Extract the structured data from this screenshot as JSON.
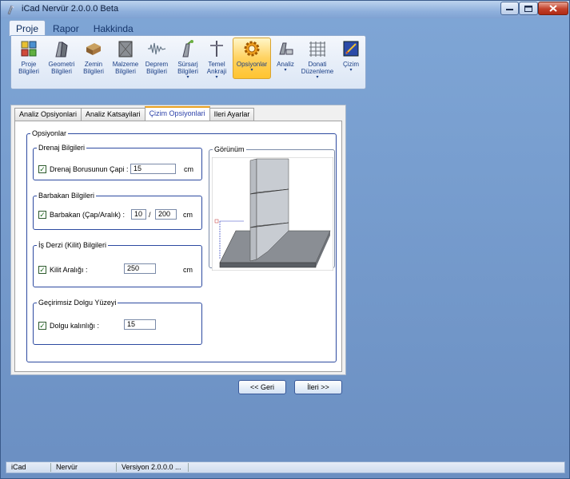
{
  "window": {
    "title": "iCad Nervür 2.0.0.0 Beta"
  },
  "ribbon": {
    "tabs": [
      {
        "label": "Proje"
      },
      {
        "label": "Rapor"
      },
      {
        "label": "Hakkinda"
      }
    ],
    "buttons": [
      {
        "label": "Proje\nBilgileri",
        "icon": "project-info-icon"
      },
      {
        "label": "Geometri\nBilgileri",
        "icon": "geometry-icon"
      },
      {
        "label": "Zemin\nBilgileri",
        "icon": "soil-icon"
      },
      {
        "label": "Malzeme\nBilgileri",
        "icon": "material-icon"
      },
      {
        "label": "Deprem\nBilgileri",
        "icon": "earthquake-icon"
      },
      {
        "label": "Sürsarj\nBilgileri",
        "icon": "surcharge-icon"
      },
      {
        "label": "Temel\nAnkraji",
        "icon": "anchor-icon"
      },
      {
        "label": "Opsiyonlar",
        "icon": "gear-icon"
      },
      {
        "label": "Analiz",
        "icon": "analysis-icon"
      },
      {
        "label": "Donati\nDüzenleme",
        "icon": "rebar-icon"
      },
      {
        "label": "Çizim",
        "icon": "drawing-icon"
      }
    ],
    "dropdown_marker": "▾"
  },
  "panel": {
    "tabs": [
      {
        "label": "Analiz Opsiyonlari"
      },
      {
        "label": "Analiz Katsayilari"
      },
      {
        "label": "Çizim Opsiyonlari"
      },
      {
        "label": "Ileri Ayarlar"
      }
    ],
    "options_legend": "Opsiyonlar",
    "drenaj": {
      "legend": "Drenaj Bilgileri",
      "label": "Drenaj Borusunun Çapi :",
      "value": "15",
      "unit": "cm",
      "checked": "✓"
    },
    "barbakan": {
      "legend": "Barbakan Bilgileri",
      "label": "Barbakan (Çap/Aralık) :",
      "value1": "10",
      "separator": "/",
      "value2": "200",
      "unit": "cm",
      "checked": "✓"
    },
    "isderzi": {
      "legend": "İş Derzi (Kilit) Bilgileri",
      "label": "Kilit Aralığı :",
      "value": "250",
      "unit": "cm",
      "checked": "✓"
    },
    "dolgu": {
      "legend": "Geçirimsiz Dolgu Yüzeyi",
      "label": "Dolgu kalınlığı :",
      "value": "15",
      "checked": "✓"
    },
    "view_legend": "Görünüm"
  },
  "nav": {
    "back": "<< Geri",
    "next": "İleri >>"
  },
  "status": {
    "items": [
      "iCad",
      "Nervür",
      "Versiyon 2.0.0.0 ..."
    ]
  },
  "colors": {
    "accent": "#2d4aa0",
    "active_ribbon": "#ffc430",
    "background": "#6f93c4"
  }
}
